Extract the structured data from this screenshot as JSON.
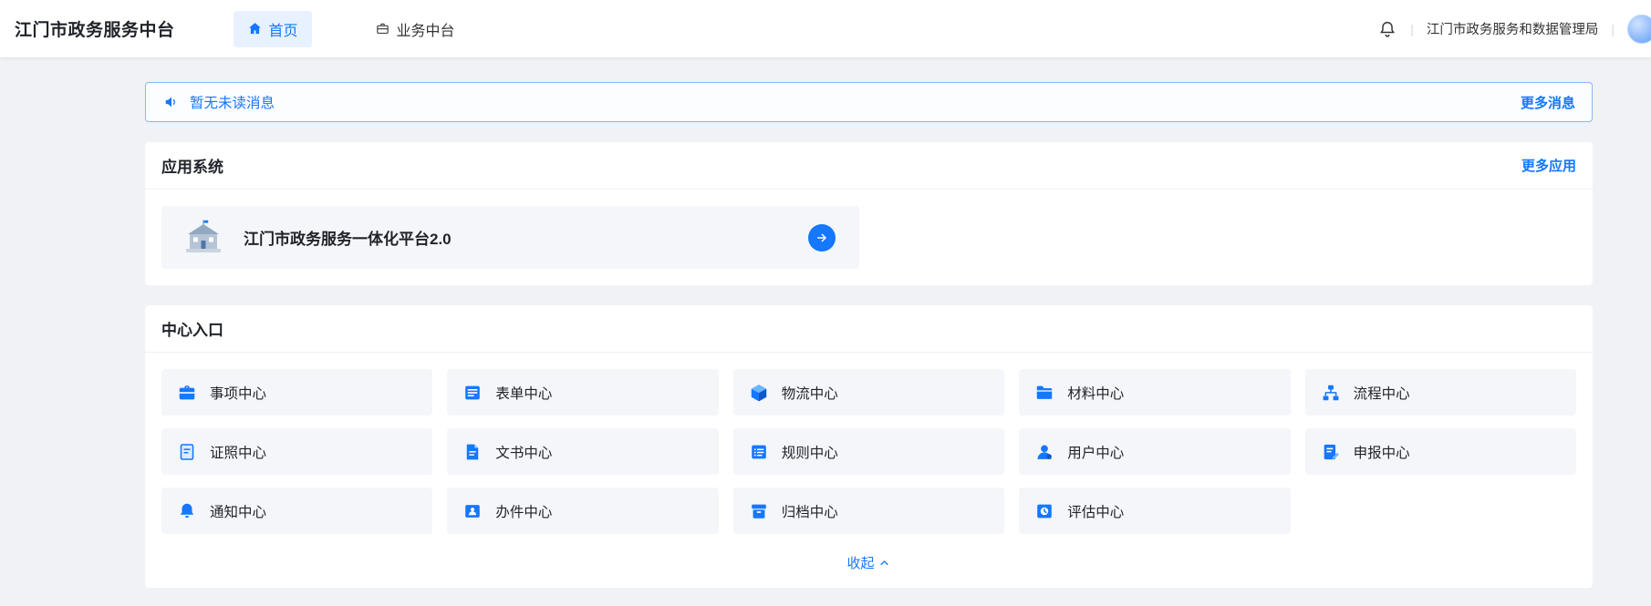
{
  "header": {
    "brand": "江门市政务服务中台",
    "nav": [
      {
        "label": "首页",
        "icon": "home-icon",
        "active": true
      },
      {
        "label": "业务中台",
        "icon": "business-icon",
        "active": false
      }
    ],
    "org": "江门市政务服务和数据管理局"
  },
  "banner": {
    "message": "暂无未读消息",
    "more": "更多消息"
  },
  "apps": {
    "title": "应用系统",
    "more": "更多应用",
    "items": [
      {
        "name": "江门市政务服务一体化平台2.0",
        "icon": "building-illustration-icon"
      }
    ]
  },
  "centers": {
    "title": "中心入口",
    "collapse": "收起",
    "items": [
      {
        "label": "事项中心",
        "icon": "briefcase-icon"
      },
      {
        "label": "表单中心",
        "icon": "form-icon"
      },
      {
        "label": "物流中心",
        "icon": "cube-icon"
      },
      {
        "label": "材料中心",
        "icon": "materials-icon"
      },
      {
        "label": "流程中心",
        "icon": "flow-icon"
      },
      {
        "label": "证照中心",
        "icon": "certificate-icon"
      },
      {
        "label": "文书中心",
        "icon": "document-icon"
      },
      {
        "label": "规则中心",
        "icon": "rules-icon"
      },
      {
        "label": "用户中心",
        "icon": "user-icon"
      },
      {
        "label": "申报中心",
        "icon": "report-icon"
      },
      {
        "label": "通知中心",
        "icon": "bell-icon"
      },
      {
        "label": "办件中心",
        "icon": "badge-icon"
      },
      {
        "label": "归档中心",
        "icon": "archive-icon"
      },
      {
        "label": "评估中心",
        "icon": "clock-icon"
      }
    ]
  },
  "colors": {
    "primary": "#1677ff",
    "page_background": "#f0f2f5",
    "tile_background": "#f4f6f9"
  }
}
